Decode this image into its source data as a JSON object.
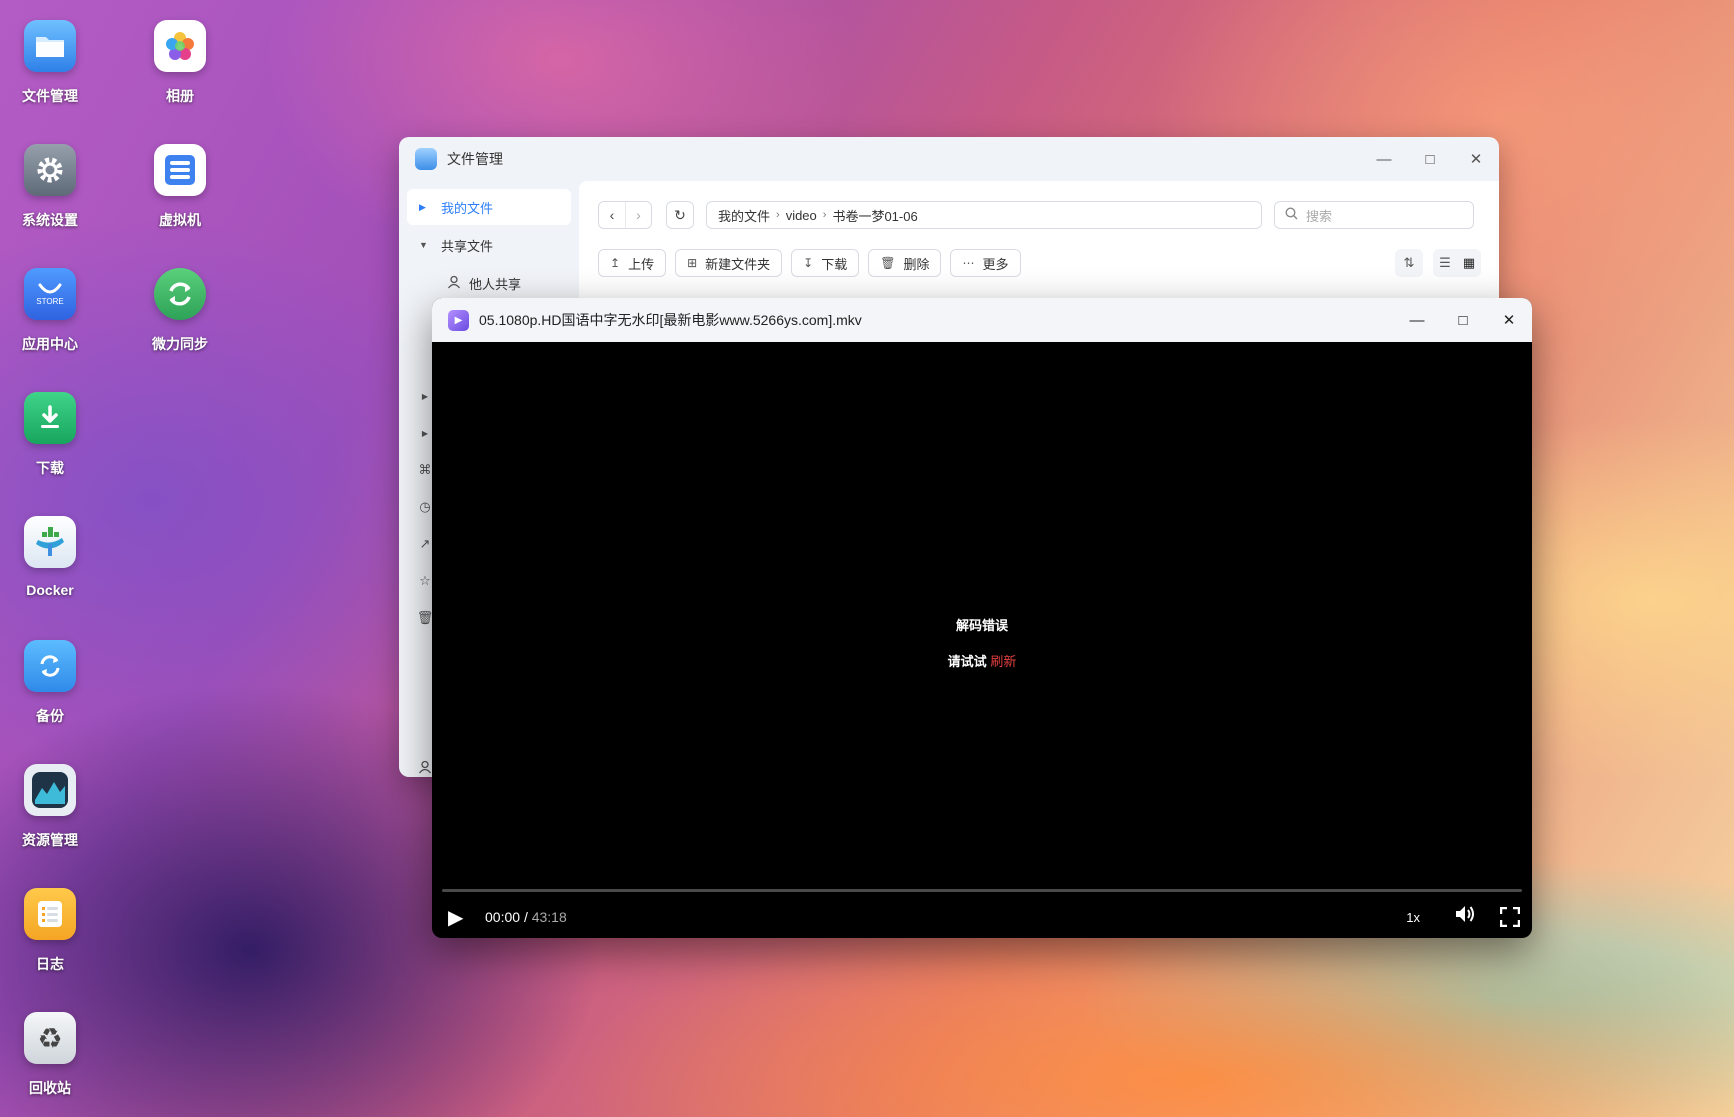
{
  "desktop": {
    "icons": [
      {
        "label": "文件管理",
        "icon": "folder-icon",
        "color": "#3d8fe8"
      },
      {
        "label": "相册",
        "icon": "photos-icon",
        "color": "#ffffff"
      },
      {
        "label": "系统设置",
        "icon": "settings-gear-icon",
        "color": "#7b8594"
      },
      {
        "label": "虚拟机",
        "icon": "virtual-machine-icon",
        "color": "#ffffff"
      },
      {
        "label": "应用中心",
        "icon": "app-store-icon",
        "color": "#3f7cf2"
      },
      {
        "label": "微力同步",
        "icon": "sync-icon",
        "color": "#35b35f"
      },
      {
        "label": "下载",
        "icon": "download-icon",
        "color": "#22b86a"
      },
      {
        "label": "Docker",
        "icon": "docker-icon",
        "color": "#ffffff"
      },
      {
        "label": "备份",
        "icon": "backup-icon",
        "color": "#3fa8f2"
      },
      {
        "label": "资源管理",
        "icon": "resource-monitor-icon",
        "color": "#1f3446"
      },
      {
        "label": "日志",
        "icon": "log-icon",
        "color": "#f7b531"
      },
      {
        "label": "回收站",
        "icon": "recycle-bin-icon",
        "color": "#e9ecef"
      }
    ],
    "store_text": "STORE"
  },
  "file_manager": {
    "title": "文件管理",
    "sidebar": {
      "my_files": "我的文件",
      "shared_files": "共享文件",
      "others_shared": "他人共享"
    },
    "path": [
      "我的文件",
      "video",
      "书卷一梦01-06"
    ],
    "search_placeholder": "搜索",
    "toolbar": {
      "upload": "上传",
      "new_folder": "新建文件夹",
      "download": "下载",
      "delete": "删除",
      "more": "更多"
    }
  },
  "player": {
    "title": "05.1080p.HD国语中字无水印[最新电影www.5266ys.com].mkv",
    "error_title": "解码错误",
    "retry_prefix": "请试试",
    "retry_link": "刷新",
    "current_time": "00:00",
    "time_separator": "/",
    "total_time": "43:18",
    "progress": 0,
    "speed": "1x"
  }
}
